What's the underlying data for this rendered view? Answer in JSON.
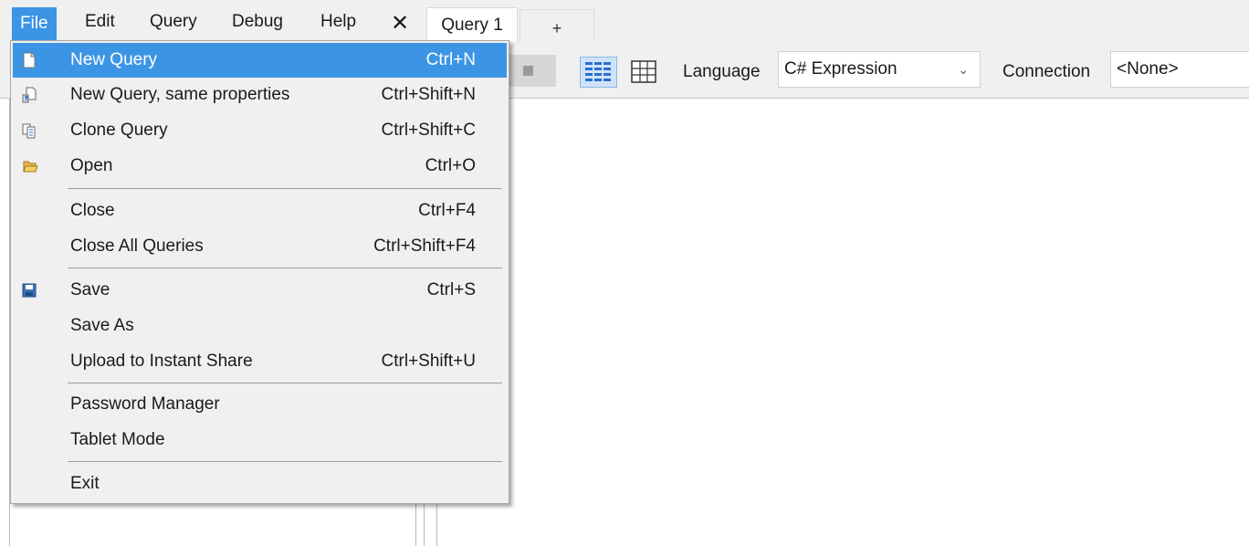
{
  "menubar": {
    "items": [
      "File",
      "Edit",
      "Query",
      "Debug",
      "Help"
    ],
    "close_glyph": "✕",
    "tab_label": "Query 1",
    "add_tab": "+"
  },
  "toolbar": {
    "language_label": "Language",
    "language_value": "C# Expression",
    "connection_label": "Connection",
    "connection_value": "<None>"
  },
  "file_menu": {
    "items": [
      {
        "label": "New Query",
        "shortcut": "Ctrl+N",
        "icon": "new-document-icon",
        "highlighted": true
      },
      {
        "label": "New Query, same properties",
        "shortcut": "Ctrl+Shift+N",
        "icon": "new-query-same-icon"
      },
      {
        "label": "Clone Query",
        "shortcut": "Ctrl+Shift+C",
        "icon": "clone-icon"
      },
      {
        "label": "Open",
        "shortcut": "Ctrl+O",
        "icon": "open-folder-icon"
      },
      {
        "label": "Close",
        "shortcut": "Ctrl+F4"
      },
      {
        "label": "Close All Queries",
        "shortcut": "Ctrl+Shift+F4"
      },
      {
        "label": "Save",
        "shortcut": "Ctrl+S",
        "icon": "save-icon"
      },
      {
        "label": "Save As",
        "shortcut": ""
      },
      {
        "label": "Upload to Instant Share",
        "shortcut": "Ctrl+Shift+U"
      },
      {
        "label": "Password Manager",
        "shortcut": ""
      },
      {
        "label": "Tablet Mode",
        "shortcut": ""
      },
      {
        "label": "Exit",
        "shortcut": ""
      }
    ]
  },
  "colors": {
    "highlight": "#3c95e4",
    "menu_bg": "#f0f0f0"
  }
}
